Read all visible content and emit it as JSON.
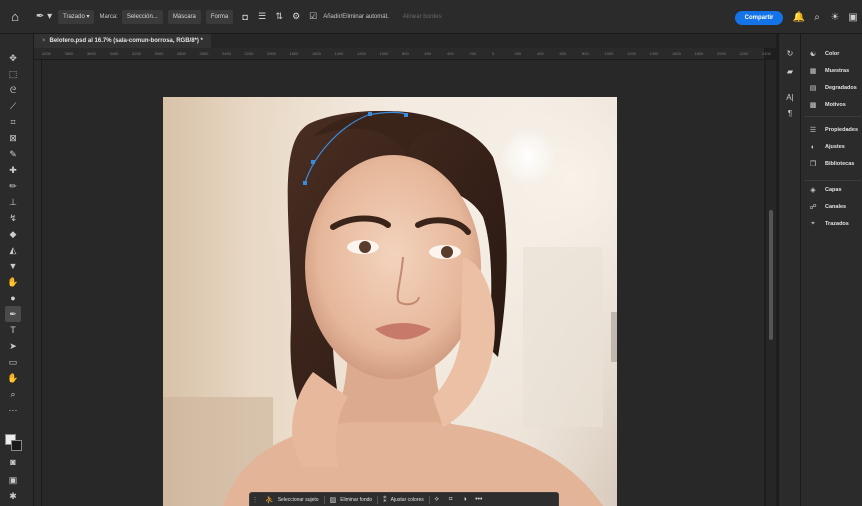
{
  "options_bar": {
    "mode_label": "Trazado",
    "mark_label": "Marca:",
    "selection_button": "Selección...",
    "mask_button": "Máscara",
    "shape_button": "Forma",
    "auto_add_label": "Añadir/Eliminar automát.",
    "align_edges_label": "Alinear bordes"
  },
  "share_button": "Compartir",
  "document_tab": {
    "close_glyph": "×",
    "title": "Belotero.psd al 16.7% (sala-comun-borrosa, RGB/8*) *"
  },
  "ruler_ticks": [
    "4200",
    "3800",
    "3600",
    "3400",
    "3200",
    "3000",
    "2800",
    "2600",
    "2400",
    "2200",
    "2000",
    "1800",
    "1600",
    "1400",
    "1200",
    "1000",
    "800",
    "600",
    "400",
    "200",
    "0",
    "200",
    "400",
    "600",
    "800",
    "1000",
    "1200",
    "1400",
    "1600",
    "1800",
    "2000",
    "2200",
    "2400"
  ],
  "right_panels": {
    "group1": [
      {
        "icon": "color-icon",
        "glyph": "☯",
        "label": "Color"
      },
      {
        "icon": "swatches-icon",
        "glyph": "▦",
        "label": "Muestras"
      },
      {
        "icon": "gradients-icon",
        "glyph": "▤",
        "label": "Degradados"
      },
      {
        "icon": "patterns-icon",
        "glyph": "▩",
        "label": "Motivos"
      }
    ],
    "group2": [
      {
        "icon": "properties-icon",
        "glyph": "☰",
        "label": "Propiedades"
      },
      {
        "icon": "adjustments-icon",
        "glyph": "◐",
        "label": "Ajustes"
      },
      {
        "icon": "libraries-icon",
        "glyph": "❐",
        "label": "Bibliotecas"
      }
    ],
    "group3": [
      {
        "icon": "layers-icon",
        "glyph": "◈",
        "label": "Capas"
      },
      {
        "icon": "channels-icon",
        "glyph": "☍",
        "label": "Canales"
      },
      {
        "icon": "paths-icon",
        "glyph": "⌖",
        "label": "Trazados"
      }
    ]
  },
  "taskbar": {
    "select_subject": "Seleccionar sujeto",
    "remove_background": "Eliminar fondo",
    "adjust_colors": "Ajustar colores",
    "more_glyph": "•••"
  },
  "colors": {
    "accent": "#1473e6",
    "app_bg": "#1e1e1e",
    "panel_bg": "#2b2b2b",
    "path_anchor": "#3a8dde"
  }
}
